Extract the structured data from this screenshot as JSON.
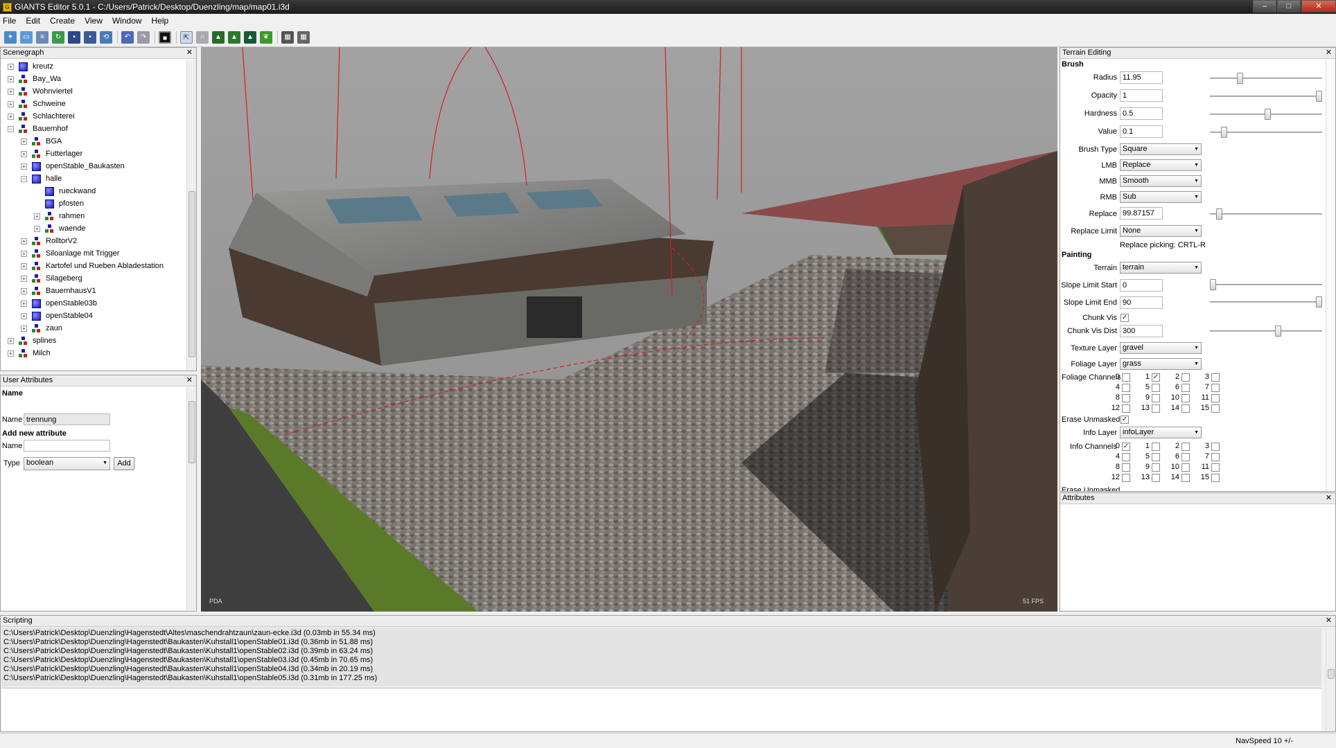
{
  "window": {
    "title": "GIANTS Editor 5.0.1 - C:/Users/Patrick/Desktop/Duenzling/map/map01.i3d",
    "min": "–",
    "max": "□",
    "close": "✕"
  },
  "menu": [
    "File",
    "Edit",
    "Create",
    "View",
    "Window",
    "Help"
  ],
  "toolbar": {
    "icons": [
      "new-icon",
      "open-icon",
      "import-icon",
      "reload-icon",
      "save-icon",
      "save-all-icon",
      "refresh-icon",
      "undo-icon",
      "redo-icon",
      "stop-icon",
      "select-icon",
      "move-icon",
      "terrain-raise-icon",
      "terrain-paint-icon",
      "terrain-smooth-icon",
      "foliage-icon",
      "grid-icon",
      "snap-icon"
    ]
  },
  "scenegraph": {
    "title": "Scenegraph",
    "close": "✕",
    "nodes": [
      {
        "label": "kreutz",
        "depth": 0,
        "icon": "mesh",
        "exp": "+"
      },
      {
        "label": "Bay_Wa",
        "depth": 0,
        "icon": "tg",
        "exp": "+"
      },
      {
        "label": "Wohnviertel",
        "depth": 0,
        "icon": "tg",
        "exp": "+"
      },
      {
        "label": "Schweine",
        "depth": 0,
        "icon": "tg",
        "exp": "+"
      },
      {
        "label": "Schlachterei",
        "depth": 0,
        "icon": "tg",
        "exp": "+"
      },
      {
        "label": "Bauernhof",
        "depth": 0,
        "icon": "tg",
        "exp": "−"
      },
      {
        "label": "BGA",
        "depth": 1,
        "icon": "tg",
        "exp": "+"
      },
      {
        "label": "Futterlager",
        "depth": 1,
        "icon": "tg",
        "exp": "+"
      },
      {
        "label": "openStable_Baukasten",
        "depth": 1,
        "icon": "mesh",
        "exp": "+"
      },
      {
        "label": "halle",
        "depth": 1,
        "icon": "mesh",
        "exp": "−"
      },
      {
        "label": "rueckwand",
        "depth": 2,
        "icon": "mesh",
        "exp": ""
      },
      {
        "label": "pfosten",
        "depth": 2,
        "icon": "mesh",
        "exp": ""
      },
      {
        "label": "rahmen",
        "depth": 2,
        "icon": "tg",
        "exp": "+"
      },
      {
        "label": "waende",
        "depth": 2,
        "icon": "tg",
        "exp": "+"
      },
      {
        "label": "RolltorV2",
        "depth": 1,
        "icon": "tg",
        "exp": "+"
      },
      {
        "label": "Siloanlage mit Trigger",
        "depth": 1,
        "icon": "tg",
        "exp": "+"
      },
      {
        "label": "Kartofel und Rueben Abladestation",
        "depth": 1,
        "icon": "tg",
        "exp": "+"
      },
      {
        "label": "Silageberg",
        "depth": 1,
        "icon": "tg",
        "exp": "+"
      },
      {
        "label": "BauernhausV1",
        "depth": 1,
        "icon": "tg",
        "exp": "+"
      },
      {
        "label": "openStable03b",
        "depth": 1,
        "icon": "mesh",
        "exp": "+"
      },
      {
        "label": "openStable04",
        "depth": 1,
        "icon": "mesh",
        "exp": "+"
      },
      {
        "label": "zaun",
        "depth": 1,
        "icon": "tg",
        "exp": "+"
      },
      {
        "label": "splines",
        "depth": 0,
        "icon": "tg",
        "exp": "+"
      },
      {
        "label": "Milch",
        "depth": 0,
        "icon": "tg",
        "exp": "+"
      }
    ]
  },
  "user_attributes": {
    "title": "User Attributes",
    "close": "✕",
    "name_heading": "Name",
    "name_label": "Name",
    "name_value": "trennung",
    "add_heading": "Add new attribute",
    "new_name_label": "Name",
    "new_name_value": "",
    "type_label": "Type",
    "type_value": "boolean",
    "add_button": "Add"
  },
  "viewport": {
    "corner_label": "PDA",
    "fps": "51 FPS"
  },
  "terrain_editing": {
    "title": "Terrain Editing",
    "close": "✕",
    "brush_heading": "Brush",
    "radius_label": "Radius",
    "radius_value": "11.95",
    "opacity_label": "Opacity",
    "opacity_value": "1",
    "hardness_label": "Hardness",
    "hardness_value": "0.5",
    "value_label": "Value",
    "value_value": "0.1",
    "brush_type_label": "Brush Type",
    "brush_type_value": "Square",
    "lmb_label": "LMB",
    "lmb_value": "Replace",
    "mmb_label": "MMB",
    "mmb_value": "Smooth",
    "rmb_label": "RMB",
    "rmb_value": "Sub",
    "replace_label": "Replace",
    "replace_value": "99.87157",
    "replace_limit_label": "Replace Limit",
    "replace_limit_value": "None",
    "replace_picking": "Replace picking: CRTL-R",
    "painting_heading": "Painting",
    "terrain_label": "Terrain",
    "terrain_value": "terrain",
    "slope_start_label": "Slope Limit Start",
    "slope_start_value": "0",
    "slope_end_label": "Slope Limit End",
    "slope_end_value": "90",
    "chunk_vis_label": "Chunk Vis",
    "chunk_vis_dist_label": "Chunk Vis Dist",
    "chunk_vis_dist_value": "300",
    "texture_layer_label": "Texture Layer",
    "texture_layer_value": "gravel",
    "foliage_layer_label": "Foliage Layer",
    "foliage_layer_value": "grass",
    "foliage_channels_label": "Foliage Channels",
    "erase_unmasked_label": "Erase Unmasked",
    "info_layer_label": "Info Layer",
    "info_layer_value": "infoLayer",
    "info_channels_label": "Info Channels",
    "erase_unmasked_2_label": "Erase Unmasked",
    "channels": [
      "0",
      "1",
      "2",
      "3",
      "4",
      "5",
      "6",
      "7",
      "8",
      "9",
      "10",
      "11",
      "12",
      "13",
      "14",
      "15"
    ],
    "check_mark": "✓"
  },
  "attributes": {
    "title": "Attributes",
    "close": "✕"
  },
  "scripting": {
    "title": "Scripting",
    "close": "✕",
    "log": [
      "C:\\Users\\Patrick\\Desktop\\Duenzling\\Hagenstedt\\Altes\\maschendrahtzaun\\zaun-ecke.i3d (0.03mb in 55.34 ms)",
      "C:\\Users\\Patrick\\Desktop\\Duenzling\\Hagenstedt\\Baukasten\\Kuhstall1\\openStable01.i3d (0.36mb in 51.88 ms)",
      "C:\\Users\\Patrick\\Desktop\\Duenzling\\Hagenstedt\\Baukasten\\Kuhstall1\\openStable02.i3d (0.39mb in 63.24 ms)",
      "C:\\Users\\Patrick\\Desktop\\Duenzling\\Hagenstedt\\Baukasten\\Kuhstall1\\openStable03.i3d (0.45mb in 70.65 ms)",
      "C:\\Users\\Patrick\\Desktop\\Duenzling\\Hagenstedt\\Baukasten\\Kuhstall1\\openStable04.i3d (0.34mb in 20.19 ms)",
      "C:\\Users\\Patrick\\Desktop\\Duenzling\\Hagenstedt\\Baukasten\\Kuhstall1\\openStable05.i3d (0.31mb in 177.25 ms)"
    ]
  },
  "status": {
    "navspeed": "NavSpeed 10 +/-"
  }
}
